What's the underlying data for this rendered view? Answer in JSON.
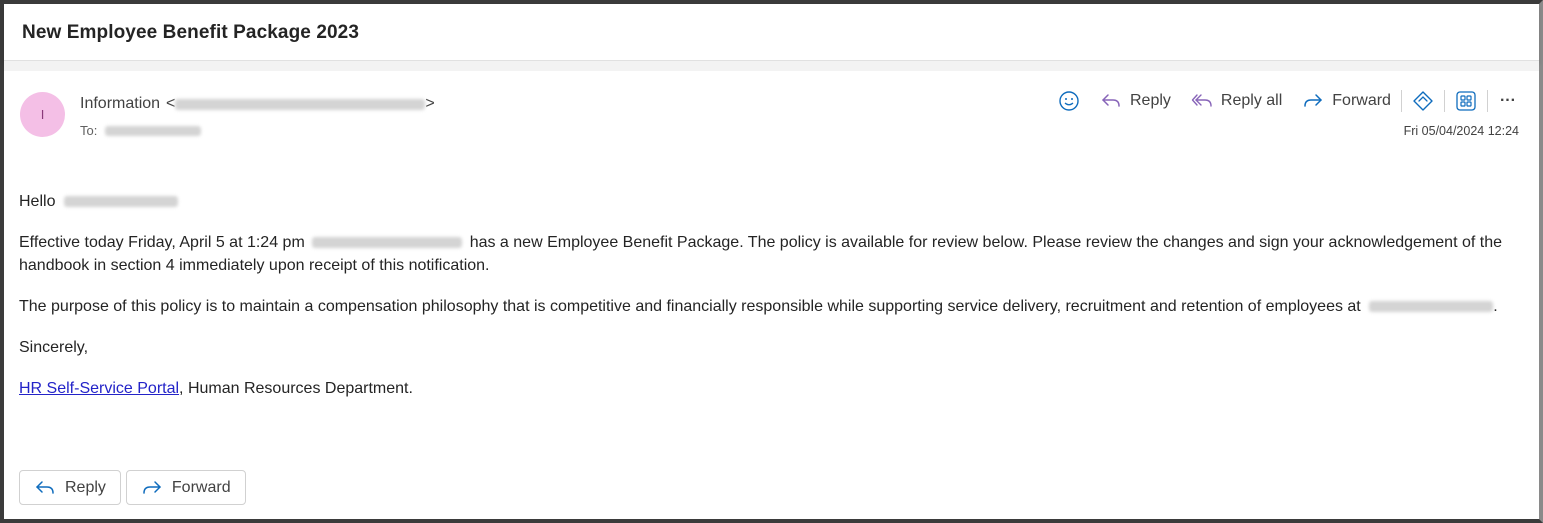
{
  "message": {
    "subject": "New Employee Benefit Package 2023",
    "sender": {
      "avatar_initial": "I",
      "name": "Information",
      "email_open": "<",
      "email_close": ">"
    },
    "to_label": "To:",
    "timestamp": "Fri 05/04/2024 12:24"
  },
  "toolbar": {
    "reply_label": "Reply",
    "reply_all_label": "Reply all",
    "forward_label": "Forward",
    "more_label": "···"
  },
  "body": {
    "greeting": "Hello",
    "p1_start": "Effective today Friday, April 5 at 1:24 pm",
    "p1_end": "has a new Employee Benefit Package. The policy is available for review below. Please review the changes and sign your acknowledgement of the handbook in section 4 immediately upon receipt of this notification.",
    "p2_start": "The purpose of this policy is to maintain a compensation philosophy that is competitive and financially responsible while supporting service delivery, recruitment and retention of employees at",
    "p2_end": ".",
    "closing": "Sincerely,",
    "link_text": "HR Self-Service Portal",
    "signature_rest": ", Human Resources Department."
  },
  "bottom": {
    "reply_label": "Reply",
    "forward_label": "Forward"
  },
  "colors": {
    "accent": "#0f6cbd",
    "reply_all_purple": "#8764b8",
    "avatar_bg": "#f4bfe6",
    "link": "#2323c8"
  }
}
